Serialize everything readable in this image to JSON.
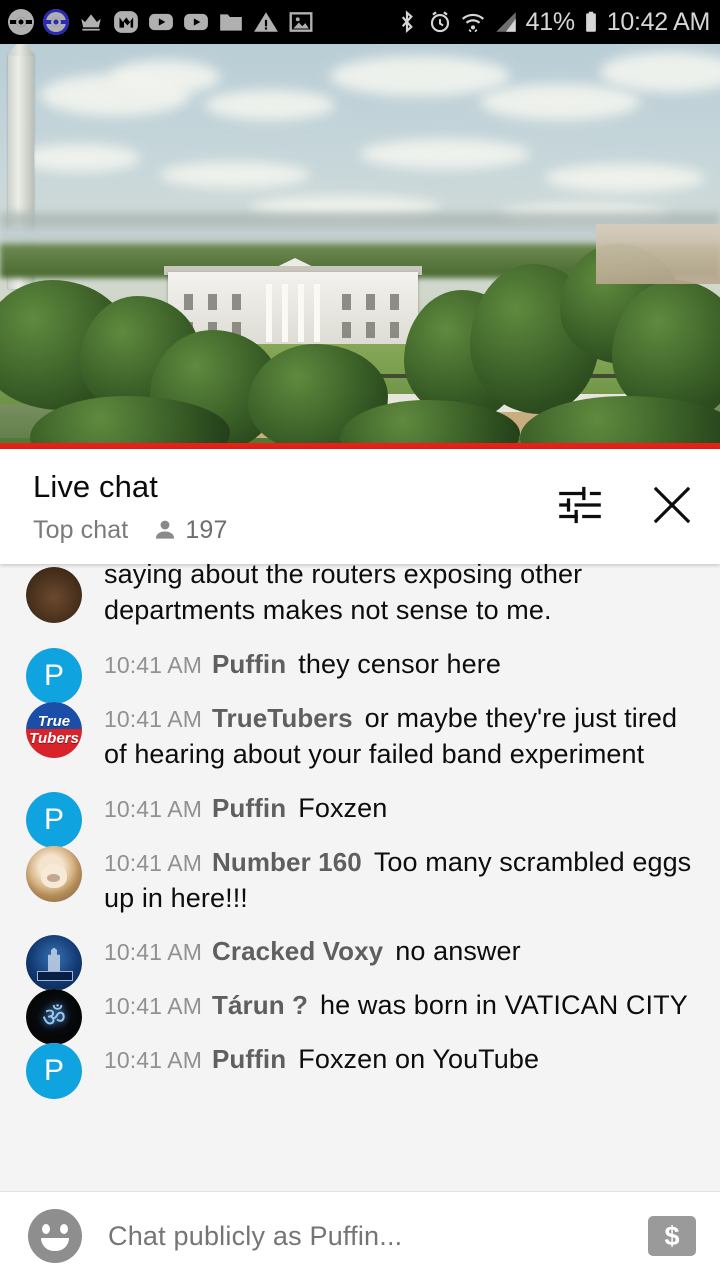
{
  "statusbar": {
    "left_icons": [
      {
        "name": "pokeball-grey-icon"
      },
      {
        "name": "pokeball-blue-icon"
      },
      {
        "name": "crown-icon"
      },
      {
        "name": "mega-app-icon"
      },
      {
        "name": "youtube-icon"
      },
      {
        "name": "youtube-icon"
      },
      {
        "name": "folder-icon"
      },
      {
        "name": "warning-triangle-icon"
      },
      {
        "name": "image-icon"
      }
    ],
    "right_icons": [
      {
        "name": "bluetooth-icon"
      },
      {
        "name": "alarm-clock-icon"
      },
      {
        "name": "wifi-icon"
      },
      {
        "name": "cellular-signal-icon"
      }
    ],
    "battery_percent": "41%",
    "time": "10:42 AM"
  },
  "video": {
    "description": "Live stream of the White House in Washington DC with the Washington Monument at left",
    "progress_color": "#e62117"
  },
  "chat_header": {
    "title": "Live chat",
    "mode": "Top chat",
    "viewer_count": "197",
    "settings_icon": "chat-settings-icon",
    "close_icon": "close-icon"
  },
  "messages": [
    {
      "avatar_type": "dark",
      "avatar_name": "avatar-unknown",
      "time": "",
      "author": "",
      "text": "saying about the routers exposing other departments makes not sense to me.",
      "clipped": true
    },
    {
      "avatar_type": "letter",
      "avatar_letter": "P",
      "avatar_color": "#0fa3e0",
      "avatar_name": "avatar-puffin",
      "time": "10:41 AM",
      "author": "Puffin",
      "text": "they censor here"
    },
    {
      "avatar_type": "truetubers",
      "avatar_name": "avatar-truetubers",
      "avatar_line1": "True",
      "avatar_line2": "Tubers",
      "time": "10:41 AM",
      "author": "TrueTubers",
      "text": "or maybe they're just tired of hearing about your failed band experiment"
    },
    {
      "avatar_type": "letter",
      "avatar_letter": "P",
      "avatar_color": "#0fa3e0",
      "avatar_name": "avatar-puffin",
      "time": "10:41 AM",
      "author": "Puffin",
      "text": "Foxzen"
    },
    {
      "avatar_type": "photo",
      "avatar_name": "avatar-number-160",
      "time": "10:41 AM",
      "author": "Number 160",
      "text": "Too many scrambled eggs up in here!!!"
    },
    {
      "avatar_type": "castle",
      "avatar_name": "avatar-cracked-voxy",
      "time": "10:41 AM",
      "author": "Cracked Voxy",
      "text": "no answer"
    },
    {
      "avatar_type": "om",
      "avatar_name": "avatar-tarun",
      "avatar_glyph": "ॐ",
      "time": "10:41 AM",
      "author": "Tárun ?",
      "text": "he was born in VATICAN CITY"
    },
    {
      "avatar_type": "letter",
      "avatar_letter": "P",
      "avatar_color": "#0fa3e0",
      "avatar_name": "avatar-puffin",
      "time": "10:41 AM",
      "author": "Puffin",
      "text": "Foxzen on YouTube"
    }
  ],
  "input_bar": {
    "emoji_icon": "emoji-smiley-icon",
    "placeholder": "Chat publicly as Puffin...",
    "superchat_icon": "super-chat-dollar-icon",
    "superchat_glyph": "$"
  }
}
